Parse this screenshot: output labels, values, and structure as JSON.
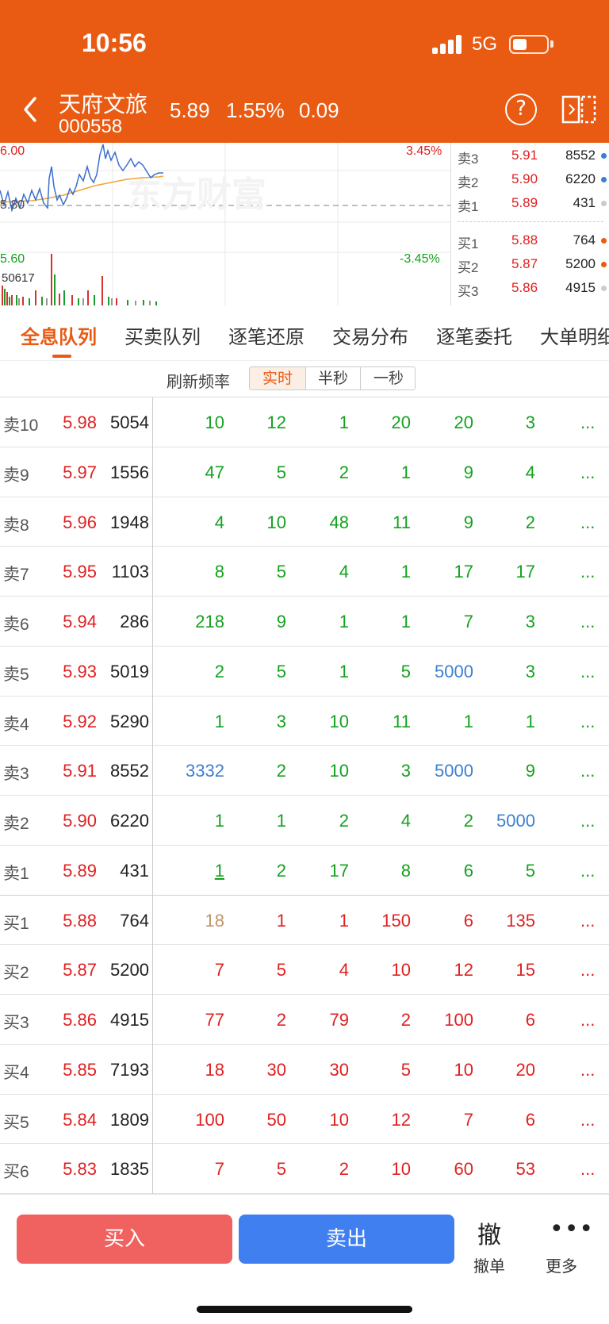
{
  "status": {
    "time": "10:56",
    "network": "5G"
  },
  "stock": {
    "name": "天府文旅",
    "code": "000558",
    "price": "5.89",
    "pct": "1.55%",
    "change": "0.09"
  },
  "chart": {
    "price_high": "6.00",
    "price_mid": "5.80",
    "price_low": "5.60",
    "pct_high": "3.45%",
    "pct_low": "-3.45%",
    "volume": "50617",
    "watermark": "东方财富"
  },
  "order_book": {
    "asks": [
      {
        "label": "卖3",
        "price": "5.91",
        "volume": "8552",
        "dot": "#3d7fd0"
      },
      {
        "label": "卖2",
        "price": "5.90",
        "volume": "6220",
        "dot": "#3d7fd0"
      },
      {
        "label": "卖1",
        "price": "5.89",
        "volume": "431",
        "dot": "#cccccc"
      }
    ],
    "bids": [
      {
        "label": "买1",
        "price": "5.88",
        "volume": "764",
        "dot": "#e95b12"
      },
      {
        "label": "买2",
        "price": "5.87",
        "volume": "5200",
        "dot": "#e95b12"
      },
      {
        "label": "买3",
        "price": "5.86",
        "volume": "4915",
        "dot": "#cccccc"
      }
    ]
  },
  "tabs": [
    "全息队列",
    "买卖队列",
    "逐笔还原",
    "交易分布",
    "逐笔委托",
    "大单明细"
  ],
  "refresh": {
    "label": "刷新频率",
    "options": [
      "实时",
      "半秒",
      "一秒"
    ]
  },
  "queue": {
    "more_label": "...",
    "rows": [
      {
        "label": "卖10",
        "price": "5.98",
        "volume": "5054",
        "cells": [
          [
            "10",
            "green"
          ],
          [
            "12",
            "green"
          ],
          [
            "1",
            "green"
          ],
          [
            "20",
            "green"
          ],
          [
            "20",
            "green"
          ],
          [
            "3",
            "green"
          ]
        ]
      },
      {
        "label": "卖9",
        "price": "5.97",
        "volume": "1556",
        "cells": [
          [
            "47",
            "green"
          ],
          [
            "5",
            "green"
          ],
          [
            "2",
            "green"
          ],
          [
            "1",
            "green"
          ],
          [
            "9",
            "green"
          ],
          [
            "4",
            "green"
          ]
        ]
      },
      {
        "label": "卖8",
        "price": "5.96",
        "volume": "1948",
        "cells": [
          [
            "4",
            "green"
          ],
          [
            "10",
            "green"
          ],
          [
            "48",
            "green"
          ],
          [
            "11",
            "green"
          ],
          [
            "9",
            "green"
          ],
          [
            "2",
            "green"
          ]
        ]
      },
      {
        "label": "卖7",
        "price": "5.95",
        "volume": "1103",
        "cells": [
          [
            "8",
            "green"
          ],
          [
            "5",
            "green"
          ],
          [
            "4",
            "green"
          ],
          [
            "1",
            "green"
          ],
          [
            "17",
            "green"
          ],
          [
            "17",
            "green"
          ]
        ]
      },
      {
        "label": "卖6",
        "price": "5.94",
        "volume": "286",
        "cells": [
          [
            "218",
            "green"
          ],
          [
            "9",
            "green"
          ],
          [
            "1",
            "green"
          ],
          [
            "1",
            "green"
          ],
          [
            "7",
            "green"
          ],
          [
            "3",
            "green"
          ]
        ]
      },
      {
        "label": "卖5",
        "price": "5.93",
        "volume": "5019",
        "cells": [
          [
            "2",
            "green"
          ],
          [
            "5",
            "green"
          ],
          [
            "1",
            "green"
          ],
          [
            "5",
            "green"
          ],
          [
            "5000",
            "blue"
          ],
          [
            "3",
            "green"
          ]
        ]
      },
      {
        "label": "卖4",
        "price": "5.92",
        "volume": "5290",
        "cells": [
          [
            "1",
            "green"
          ],
          [
            "3",
            "green"
          ],
          [
            "10",
            "green"
          ],
          [
            "11",
            "green"
          ],
          [
            "1",
            "green"
          ],
          [
            "1",
            "green"
          ]
        ]
      },
      {
        "label": "卖3",
        "price": "5.91",
        "volume": "8552",
        "cells": [
          [
            "3332",
            "blue"
          ],
          [
            "2",
            "green"
          ],
          [
            "10",
            "green"
          ],
          [
            "3",
            "green"
          ],
          [
            "5000",
            "blue"
          ],
          [
            "9",
            "green"
          ]
        ]
      },
      {
        "label": "卖2",
        "price": "5.90",
        "volume": "6220",
        "cells": [
          [
            "1",
            "green"
          ],
          [
            "1",
            "green"
          ],
          [
            "2",
            "green"
          ],
          [
            "4",
            "green"
          ],
          [
            "2",
            "green"
          ],
          [
            "5000",
            "blue"
          ]
        ]
      },
      {
        "label": "卖1",
        "price": "5.89",
        "volume": "431",
        "cells": [
          [
            "1",
            "green-u"
          ],
          [
            "2",
            "green"
          ],
          [
            "17",
            "green"
          ],
          [
            "8",
            "green"
          ],
          [
            "6",
            "green"
          ],
          [
            "5",
            "green"
          ]
        ]
      },
      {
        "label": "买1",
        "price": "5.88",
        "volume": "764",
        "cells": [
          [
            "18",
            "tan"
          ],
          [
            "1",
            "red"
          ],
          [
            "1",
            "red"
          ],
          [
            "150",
            "red"
          ],
          [
            "6",
            "red"
          ],
          [
            "135",
            "red"
          ]
        ]
      },
      {
        "label": "买2",
        "price": "5.87",
        "volume": "5200",
        "cells": [
          [
            "7",
            "red"
          ],
          [
            "5",
            "red"
          ],
          [
            "4",
            "red"
          ],
          [
            "10",
            "red"
          ],
          [
            "12",
            "red"
          ],
          [
            "15",
            "red"
          ]
        ]
      },
      {
        "label": "买3",
        "price": "5.86",
        "volume": "4915",
        "cells": [
          [
            "77",
            "red"
          ],
          [
            "2",
            "red"
          ],
          [
            "79",
            "red"
          ],
          [
            "2",
            "red"
          ],
          [
            "100",
            "red"
          ],
          [
            "6",
            "red"
          ]
        ]
      },
      {
        "label": "买4",
        "price": "5.85",
        "volume": "7193",
        "cells": [
          [
            "18",
            "red"
          ],
          [
            "30",
            "red"
          ],
          [
            "30",
            "red"
          ],
          [
            "5",
            "red"
          ],
          [
            "10",
            "red"
          ],
          [
            "20",
            "red"
          ]
        ]
      },
      {
        "label": "买5",
        "price": "5.84",
        "volume": "1809",
        "cells": [
          [
            "100",
            "red"
          ],
          [
            "50",
            "red"
          ],
          [
            "10",
            "red"
          ],
          [
            "12",
            "red"
          ],
          [
            "7",
            "red"
          ],
          [
            "6",
            "red"
          ]
        ]
      },
      {
        "label": "买6",
        "price": "5.83",
        "volume": "1835",
        "cells": [
          [
            "7",
            "red"
          ],
          [
            "5",
            "red"
          ],
          [
            "2",
            "red"
          ],
          [
            "10",
            "red"
          ],
          [
            "60",
            "red"
          ],
          [
            "53",
            "red"
          ]
        ]
      }
    ]
  },
  "actions": {
    "buy": "买入",
    "sell": "卖出",
    "cancel_icon": "撤",
    "cancel": "撤单",
    "more_icon": "•••",
    "more": "更多"
  },
  "colors": {
    "accent": "#e95b12",
    "up": "#e02020",
    "down": "#13a21e",
    "buy_btn": "#f0625f",
    "sell_btn": "#3f7ff0"
  }
}
